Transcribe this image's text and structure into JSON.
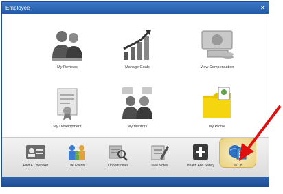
{
  "window": {
    "title": "Employee",
    "close_label": "×"
  },
  "main_grid": [
    {
      "id": "reviews",
      "label": "My Reviews",
      "icon": "reviews-people-icon"
    },
    {
      "id": "goals",
      "label": "Manage Goals",
      "icon": "growth-chart-icon"
    },
    {
      "id": "compensation",
      "label": "View Compensation",
      "icon": "money-icon"
    },
    {
      "id": "development",
      "label": "My Development",
      "icon": "certificate-icon"
    },
    {
      "id": "mentors",
      "label": "My Mentors",
      "icon": "mentors-icon"
    },
    {
      "id": "profile",
      "label": "My Profile",
      "icon": "folder-icon"
    }
  ],
  "bottom_bar": [
    {
      "id": "find-coworker",
      "label": "Find A Coworker",
      "icon": "id-card-icon"
    },
    {
      "id": "life-events",
      "label": "Life Events",
      "icon": "family-icon"
    },
    {
      "id": "opportunities",
      "label": "Opportunities",
      "icon": "search-document-icon"
    },
    {
      "id": "take-notes",
      "label": "Take Notes",
      "icon": "notepad-pen-icon"
    },
    {
      "id": "health-safety",
      "label": "Health And Safety",
      "icon": "health-cross-icon"
    },
    {
      "id": "to-do",
      "label": "To Do",
      "icon": "todo-globe-icon"
    }
  ],
  "colors": {
    "title_bar": "#2a62ae",
    "arrow": "#e01010"
  }
}
